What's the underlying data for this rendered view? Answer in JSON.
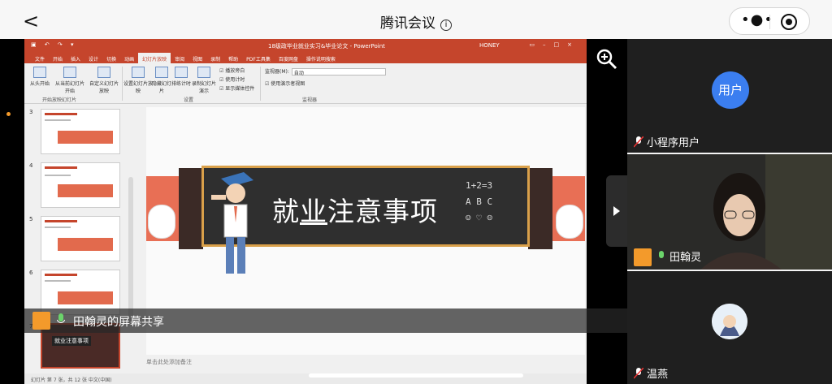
{
  "app": {
    "title": "腾讯会议",
    "back_label": "<"
  },
  "share": {
    "caption": "田翰灵的屏幕共享",
    "ppt": {
      "doc_title": "18级政毕业就业实习&毕业论文 - PowerPoint",
      "user": "HONEY",
      "tabs": [
        "文件",
        "开始",
        "插入",
        "设计",
        "切换",
        "动画",
        "幻灯片放映",
        "审阅",
        "视图",
        "录制",
        "帮助",
        "PDF工具集",
        "百度网盘",
        "操作说明搜索"
      ],
      "active_tab": "幻灯片放映",
      "ribbon": {
        "btn1": "从头开始",
        "btn2": "从当前幻灯片开始",
        "btn3": "自定义幻灯片放映",
        "btn4": "设置幻灯片放映",
        "btn5": "隐藏幻灯片",
        "btn6": "排练计时",
        "btn7": "录制幻灯片演示",
        "group1": "开始放映幻灯片",
        "group2": "设置",
        "group3": "监视器",
        "chk1": "播放旁白",
        "chk2": "使用计时",
        "chk3": "显示媒体控件",
        "monitor_label": "监视器(M):",
        "monitor_value": "自动",
        "presenter_view": "使用演示者视图"
      },
      "thumb_numbers": [
        "3",
        "4",
        "5",
        "6",
        "7"
      ],
      "selected_thumb_label": "就业注意事项",
      "slide": {
        "title_part1": "就",
        "title_part2": "业",
        "title_part3": "注意事项",
        "doodle_line1": "1+2=3",
        "doodle_line2": "A  B  C",
        "doodle_line3": "☺ ♡ ☹"
      },
      "notes_placeholder": "单击此处添加备注",
      "status": "幻灯片 第 7 张，共 12 张    中文(中国)"
    }
  },
  "participants": [
    {
      "name": "小程序用户",
      "avatar_text": "用户"
    },
    {
      "name": "田翰灵"
    },
    {
      "name": "温燕"
    }
  ],
  "colors": {
    "accent": "#3b7ef0",
    "ppt_red": "#c5452c",
    "slide_orange": "#e86f55",
    "avatar_orange": "#f39a2b"
  }
}
